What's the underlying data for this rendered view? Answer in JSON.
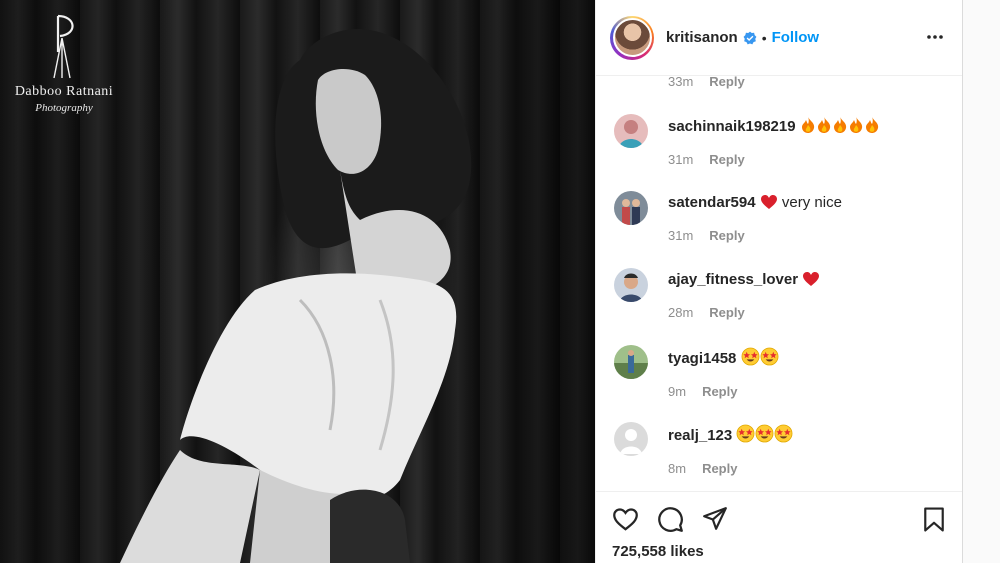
{
  "photo": {
    "watermark_name": "Dabboo Ratnani",
    "watermark_sub": "Photography"
  },
  "header": {
    "username": "kritisanon",
    "separator": "•",
    "follow_label": "Follow"
  },
  "top_meta": {
    "time": "33m",
    "reply_label": "Reply"
  },
  "comments": [
    {
      "user": "sachinnaik198219",
      "text": "",
      "emoji": [
        "fire",
        "fire",
        "fire",
        "fire",
        "fire"
      ],
      "time": "31m",
      "reply_label": "Reply",
      "avatar_color": "#d9a0a0"
    },
    {
      "user": "satendar594",
      "text": "very nice",
      "emoji": [
        "heart"
      ],
      "time": "31m",
      "reply_label": "Reply",
      "avatar_color": "#5b6b7c"
    },
    {
      "user": "ajay_fitness_lover",
      "text": "",
      "emoji": [
        "heart"
      ],
      "time": "28m",
      "reply_label": "Reply",
      "avatar_color": "#9aa6b8"
    },
    {
      "user": "tyagi1458",
      "text": "",
      "emoji": [
        "starstruck",
        "starstruck"
      ],
      "time": "9m",
      "reply_label": "Reply",
      "avatar_color": "#6c8f5a"
    },
    {
      "user": "realj_123",
      "text": "",
      "emoji": [
        "starstruck",
        "starstruck",
        "starstruck"
      ],
      "time": "8m",
      "reply_label": "Reply",
      "avatar_color": "#dbdbdb"
    }
  ],
  "footer": {
    "likes": "725,558 likes"
  },
  "colors": {
    "accent": "#0095f6",
    "muted": "#8e8e8e",
    "heart": "#ed4956"
  }
}
